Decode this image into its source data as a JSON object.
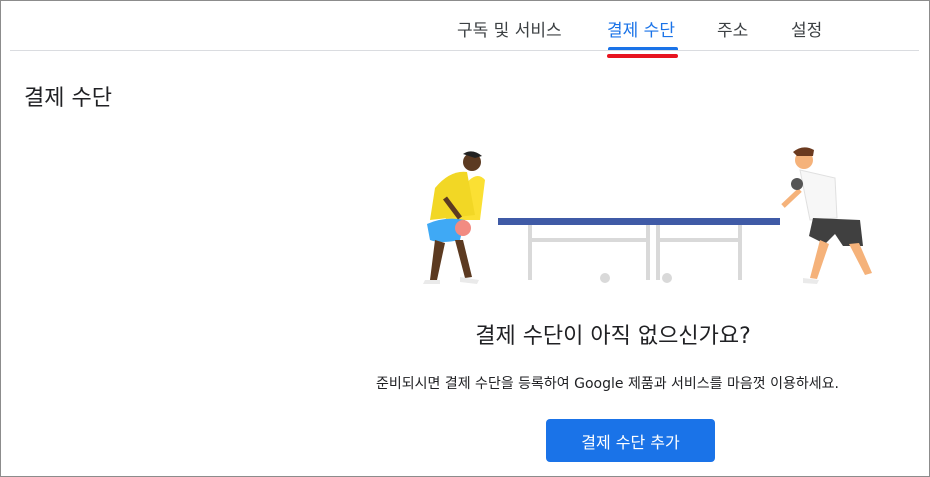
{
  "tabs": [
    {
      "label": "구독 및 서비스",
      "active": false
    },
    {
      "label": "결제 수단",
      "active": true
    },
    {
      "label": "주소",
      "active": false
    },
    {
      "label": "설정",
      "active": false
    }
  ],
  "page_title": "결제 수단",
  "empty_state": {
    "heading": "결제 수단이 아직 없으신가요?",
    "description": "준비되시면 결제 수단을 등록하여 Google 제품과 서비스를 마음껏 이용하세요.",
    "add_button": "결제 수단 추가"
  },
  "colors": {
    "accent": "#1a73e8",
    "highlight_underline": "#e8141f"
  }
}
